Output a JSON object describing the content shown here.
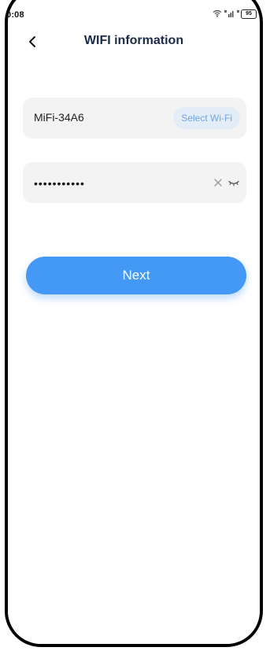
{
  "status_bar": {
    "time": "0:08",
    "battery": "95"
  },
  "header": {
    "title": "WIFI information",
    "back_icon": "chevron-left-icon"
  },
  "form": {
    "ssid_value": "MiFi-34A6",
    "select_wifi_label": "Select Wi-Fi",
    "password_value": "•••••••••••",
    "clear_icon": "close-icon",
    "toggle_icon": "eye-closed-icon"
  },
  "actions": {
    "next_label": "Next"
  },
  "colors": {
    "accent": "#4599f6",
    "field_bg": "#f3f3f3",
    "chip_bg": "#e3edf8",
    "chip_text": "#6fa5e0",
    "title": "#1b2a47"
  }
}
